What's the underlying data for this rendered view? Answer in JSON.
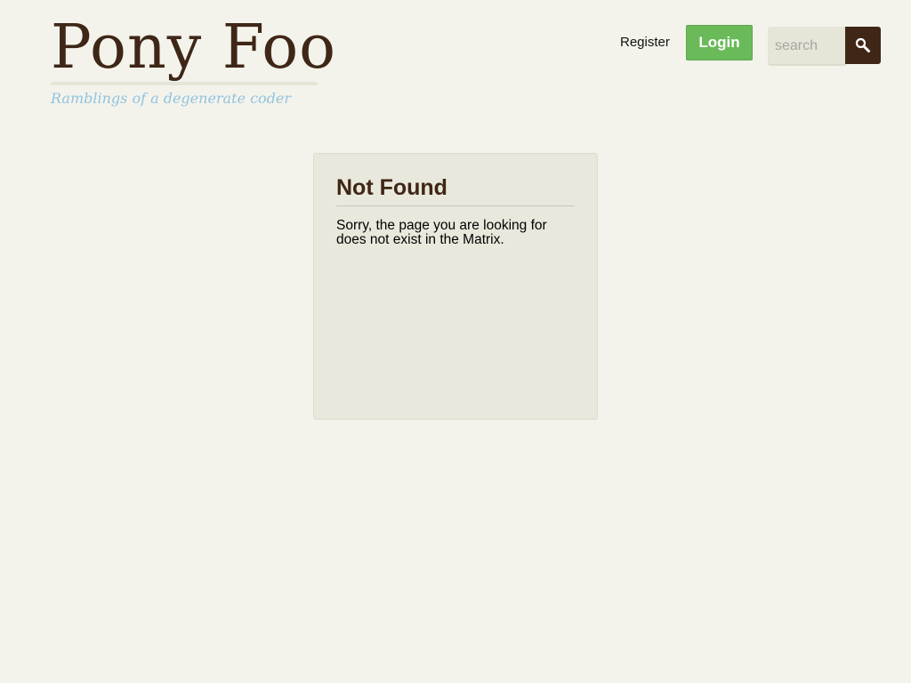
{
  "header": {
    "logo_text": "Pony Foo",
    "tagline": "Ramblings of a degenerate coder"
  },
  "nav": {
    "register_label": "Register",
    "login_label": "Login"
  },
  "search": {
    "placeholder": "search",
    "icon": "search-icon"
  },
  "not_found": {
    "title": "Not Found",
    "message": "Sorry, the page you are looking for does not exist in the Matrix."
  },
  "colors": {
    "background": "#f3f3ec",
    "brand_brown": "#3f2616",
    "tagline_blue": "#92c3dd",
    "login_green": "#6aba5a",
    "card_background": "#e9e8dc"
  }
}
